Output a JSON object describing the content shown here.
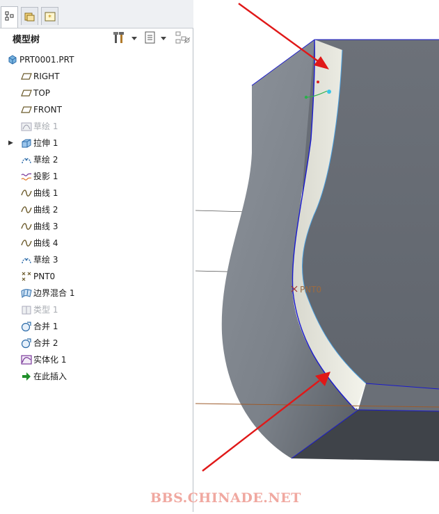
{
  "panel": {
    "tabs": [
      {
        "name": "model-tree"
      },
      {
        "name": "folder-browser"
      },
      {
        "name": "favorites"
      }
    ],
    "title": "模型树",
    "toolbar": {
      "icons": [
        "tools-icon",
        "settings-dropdown-icon",
        "columns-icon",
        "show-dropdown-icon",
        "filter-icon"
      ]
    },
    "tree": [
      {
        "label": "PRT0001.PRT",
        "icon": "part-icon",
        "dim": false,
        "indent": 0,
        "expander": ""
      },
      {
        "label": "RIGHT",
        "icon": "datum-plane-icon",
        "dim": false,
        "indent": 1,
        "expander": ""
      },
      {
        "label": "TOP",
        "icon": "datum-plane-icon",
        "dim": false,
        "indent": 1,
        "expander": ""
      },
      {
        "label": "FRONT",
        "icon": "datum-plane-icon",
        "dim": false,
        "indent": 1,
        "expander": ""
      },
      {
        "label": "草绘 1",
        "icon": "sketch-icon",
        "dim": true,
        "indent": 1,
        "expander": ""
      },
      {
        "label": "拉伸 1",
        "icon": "extrude-icon",
        "dim": false,
        "indent": 1,
        "expander": "▶"
      },
      {
        "label": "草绘 2",
        "icon": "sketch-arc-icon",
        "dim": false,
        "indent": 1,
        "expander": ""
      },
      {
        "label": "投影 1",
        "icon": "projection-icon",
        "dim": false,
        "indent": 1,
        "expander": ""
      },
      {
        "label": "曲线 1",
        "icon": "curve-icon",
        "dim": false,
        "indent": 1,
        "expander": ""
      },
      {
        "label": "曲线 2",
        "icon": "curve-icon",
        "dim": false,
        "indent": 1,
        "expander": ""
      },
      {
        "label": "曲线 3",
        "icon": "curve-icon",
        "dim": false,
        "indent": 1,
        "expander": ""
      },
      {
        "label": "曲线 4",
        "icon": "curve-icon",
        "dim": false,
        "indent": 1,
        "expander": ""
      },
      {
        "label": "草绘 3",
        "icon": "sketch-arc-icon",
        "dim": false,
        "indent": 1,
        "expander": ""
      },
      {
        "label": "PNT0",
        "icon": "datum-point-icon",
        "dim": false,
        "indent": 1,
        "expander": ""
      },
      {
        "label": "边界混合 1",
        "icon": "boundary-blend-icon",
        "dim": false,
        "indent": 1,
        "expander": ""
      },
      {
        "label": "类型 1",
        "icon": "type-icon",
        "dim": true,
        "indent": 1,
        "expander": ""
      },
      {
        "label": "合并 1",
        "icon": "merge-icon",
        "dim": false,
        "indent": 1,
        "expander": ""
      },
      {
        "label": "合并 2",
        "icon": "merge-icon",
        "dim": false,
        "indent": 1,
        "expander": ""
      },
      {
        "label": "实体化 1",
        "icon": "solidify-icon",
        "dim": false,
        "indent": 1,
        "expander": ""
      },
      {
        "label": "在此插入",
        "icon": "insert-here-arrow-icon",
        "dim": false,
        "indent": 1,
        "expander": ""
      }
    ]
  },
  "viewport": {
    "point_label": "PNT0",
    "colors": {
      "body_dark": "#5e636b",
      "body_light": "#9aa0a8",
      "surface": "#eeeee6",
      "edge": "#1a1acc",
      "arrow": "#e01818"
    }
  },
  "watermark": "BBS.CHINADE.NET"
}
